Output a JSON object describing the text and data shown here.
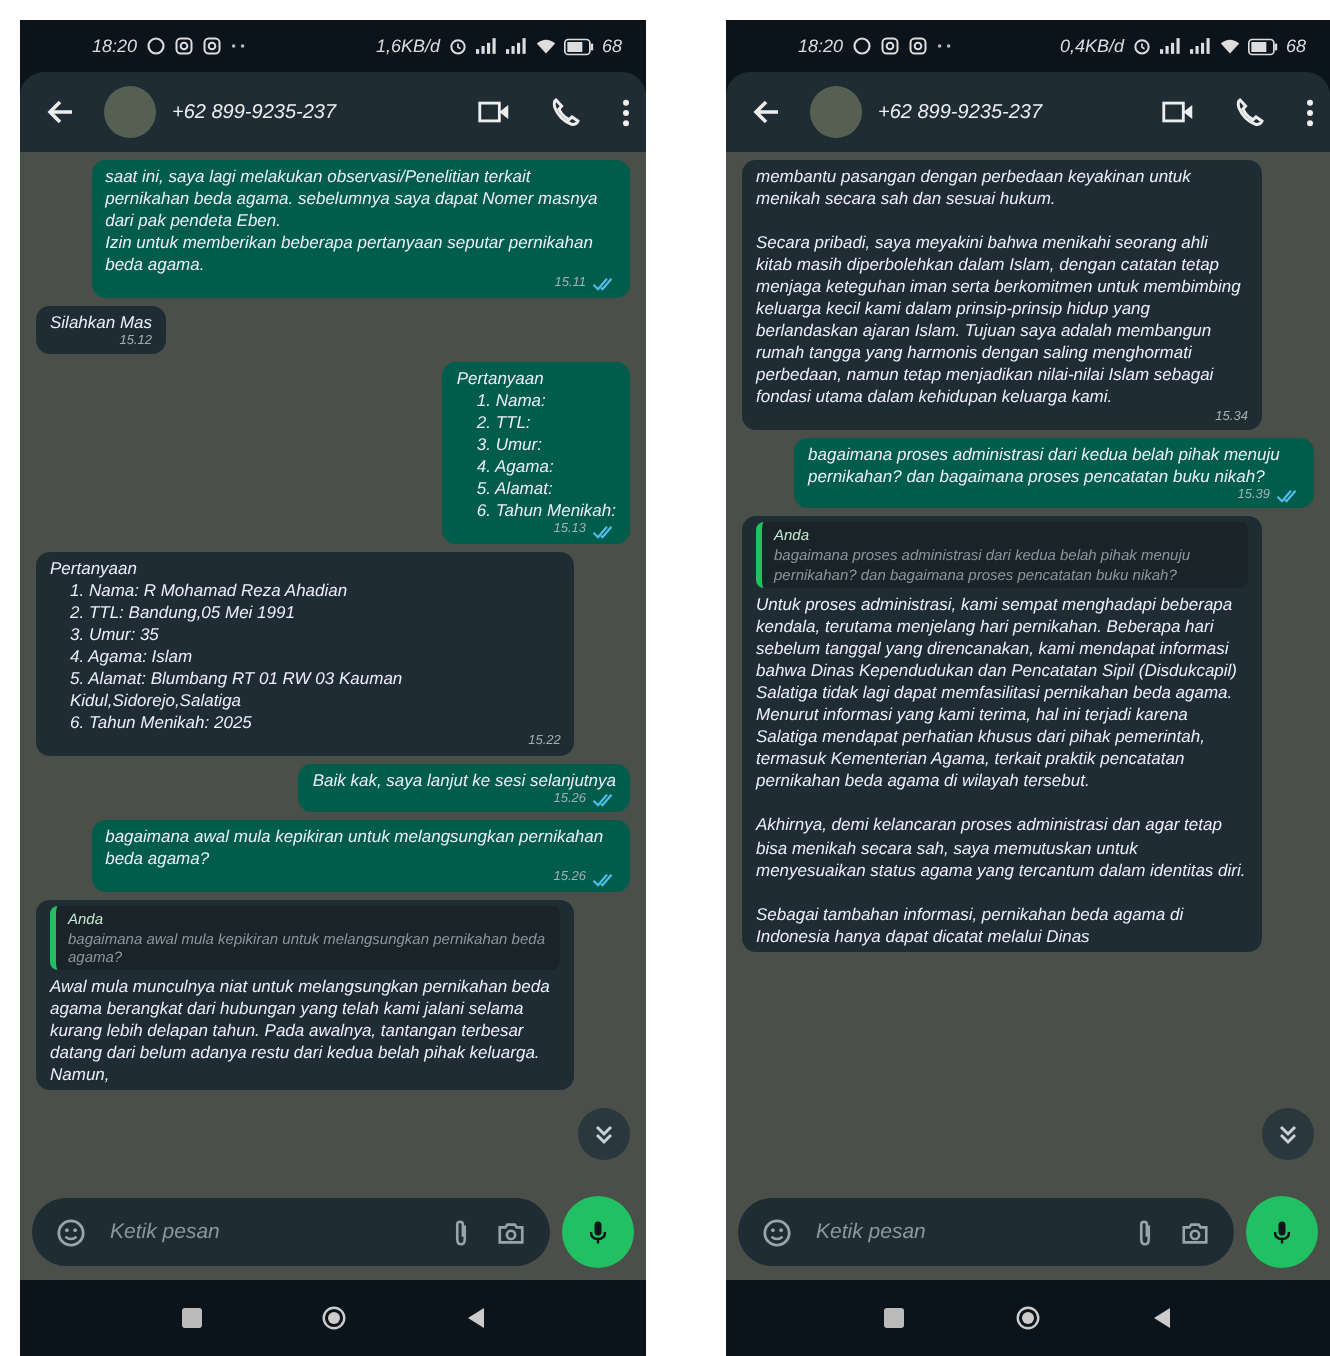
{
  "phones": [
    {
      "status_bar": {
        "time": "18:20",
        "speed": "1,6KB/d",
        "battery": "68"
      },
      "contact": {
        "name": "+62 899-9235-237"
      },
      "messages": [
        {
          "kind": "out",
          "text": "saat ini, saya lagi melakukan observasi/Penelitian terkait pernikahan beda agama. sebelumnya saya dapat Nomer masnya dari pak pendeta Eben.\nIzin untuk memberikan beberapa pertanyaan seputar pernikahan beda agama.",
          "time": "15.11",
          "read": true
        },
        {
          "kind": "in",
          "text": "Silahkan Mas",
          "time": "15.12"
        },
        {
          "kind": "out",
          "heading": "Pertanyaan",
          "items": [
            "1. Nama:",
            "2. TTL:",
            "3. Umur:",
            "4. Agama:",
            "5. Alamat:",
            "6. Tahun Menikah:"
          ],
          "time": "15.13",
          "read": true
        },
        {
          "kind": "in",
          "heading": "Pertanyaan",
          "items": [
            "1. Nama: R Mohamad Reza Ahadian",
            "2. TTL: Bandung,05 Mei 1991",
            "3. Umur: 35",
            "4. Agama: Islam",
            "5. Alamat: Blumbang RT 01 RW 03 Kauman Kidul,Sidorejo,Salatiga",
            "6. Tahun Menikah: 2025"
          ],
          "time": "15.22"
        },
        {
          "kind": "out",
          "text": "Baik kak, saya lanjut ke sesi selanjutnya",
          "time": "15.26",
          "read": true
        },
        {
          "kind": "out",
          "text": "bagaimana awal mula kepikiran untuk melangsungkan pernikahan beda agama?",
          "time": "15.26",
          "read": true
        },
        {
          "kind": "in",
          "quote": {
            "author": "Anda",
            "text": "bagaimana awal mula kepikiran untuk melangsungkan pernikahan beda agama?"
          },
          "text": "Awal mula munculnya niat untuk melangsungkan pernikahan beda agama berangkat dari hubungan yang telah kami jalani selama kurang lebih delapan tahun. Pada awalnya, tantangan terbesar datang dari belum adanya restu dari kedua belah pihak keluarga. Namun,"
        }
      ],
      "input": {
        "placeholder": "Ketik pesan"
      }
    },
    {
      "status_bar": {
        "time": "18:20",
        "speed": "0,4KB/d",
        "battery": "68"
      },
      "contact": {
        "name": "+62 899-9235-237"
      },
      "messages": [
        {
          "kind": "in",
          "text": "membantu pasangan dengan perbedaan keyakinan untuk menikah secara sah dan sesuai hukum.\n\nSecara pribadi, saya meyakini bahwa menikahi seorang ahli kitab masih diperbolehkan dalam Islam, dengan catatan tetap menjaga keteguhan iman serta berkomitmen untuk membimbing keluarga kecil kami dalam prinsip-prinsip hidup yang berlandaskan ajaran Islam. Tujuan saya adalah membangun rumah tangga yang harmonis dengan saling menghormati perbedaan, namun tetap menjadikan nilai-nilai Islam sebagai fondasi utama dalam kehidupan keluarga kami.",
          "time": "15.34"
        },
        {
          "kind": "out",
          "text": "bagaimana proses administrasi dari kedua belah pihak menuju pernikahan? dan bagaimana proses pencatatan buku nikah?",
          "time": "15.39",
          "read": true
        },
        {
          "kind": "in",
          "quote": {
            "author": "Anda",
            "text": "bagaimana proses administrasi dari kedua belah pihak menuju pernikahan? dan bagaimana proses pencatatan buku nikah?"
          },
          "text": "Untuk proses administrasi, kami sempat menghadapi beberapa kendala, terutama menjelang hari pernikahan. Beberapa hari sebelum tanggal yang direncanakan, kami mendapat informasi bahwa Dinas Kependudukan dan Pencatatan Sipil (Disdukcapil) Salatiga tidak lagi dapat memfasilitasi pernikahan beda agama. Menurut informasi yang kami terima, hal ini terjadi karena Salatiga mendapat perhatian khusus dari pihak pemerintah, termasuk Kementerian Agama, terkait praktik pencatatan pernikahan beda agama di wilayah tersebut.\n\nAkhirnya, demi kelancaran proses administrasi dan agar tetap bisa menikah secara sah, saya memutuskan untuk menyesuaikan status agama yang tercantum dalam identitas diri.\n\nSebagai tambahan informasi, pernikahan beda agama di Indonesia hanya dapat dicatat melalui Dinas"
        }
      ],
      "input": {
        "placeholder": "Ketik pesan"
      }
    }
  ]
}
